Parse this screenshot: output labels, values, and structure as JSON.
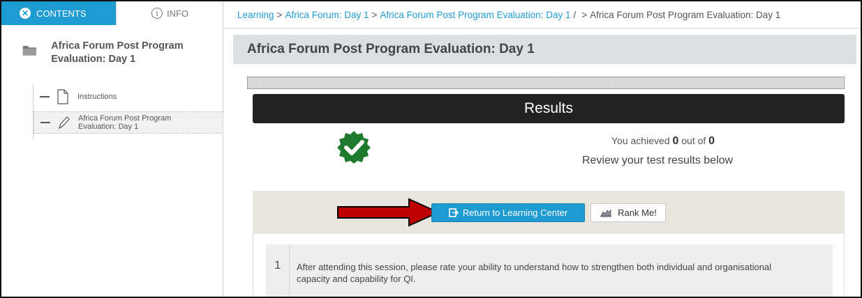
{
  "sidebar": {
    "tabs": {
      "contents": "CONTENTS",
      "info": "INFO"
    },
    "folder_title": "Africa Forum Post Program Evaluation: Day 1",
    "items": [
      {
        "label": "Instructions"
      },
      {
        "label": "Africa Forum Post Program Evaluation: Day 1"
      }
    ]
  },
  "breadcrumb": {
    "items": [
      "Learning",
      "Africa Forum: Day 1",
      "Africa Forum Post Program Evaluation: Day 1"
    ],
    "current": "Africa Forum Post Program Evaluation: Day 1"
  },
  "page_title": "Africa Forum Post Program Evaluation: Day 1",
  "results": {
    "header": "Results",
    "achieved_prefix": "You achieved",
    "score": "0",
    "out_of": "out of",
    "total": "0",
    "review_text": "Review your test results below"
  },
  "actions": {
    "return_label": "Return to Learning Center",
    "rank_label": "Rank Me!"
  },
  "question": {
    "number": "1",
    "text": "After attending this session, please rate your ability to understand how to strengthen both individual and organisational capacity and capability for QI."
  },
  "colors": {
    "accent": "#1e9bd0",
    "results_bar": "#222222",
    "badge_green": "#1e7a2c",
    "arrow_red": "#c00000"
  }
}
